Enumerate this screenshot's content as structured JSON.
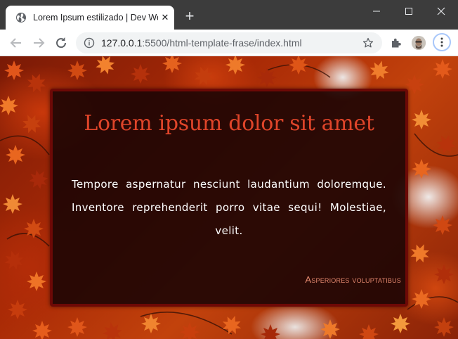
{
  "tab": {
    "title": "Lorem Ipsum estilizado | Dev Web",
    "close_icon": "close-icon",
    "favicon": "globe-icon"
  },
  "newtab": {
    "label": "+"
  },
  "address": {
    "host": "127.0.0.1",
    "rest": ":5500/html-template-frase/index.html"
  },
  "colors": {
    "titlebar": "#3c3c3c",
    "card_border": "#6d0906",
    "title": "#e0452a",
    "author": "#e1866d"
  },
  "quote": {
    "title": "Lorem ipsum dolor sit amet",
    "text": "Tempore aspernatur nesciunt laudantium doloremque. Inventore reprehenderit porro vitae sequi! Molestiae, velit.",
    "author": "Asperiores voluptatibus"
  }
}
